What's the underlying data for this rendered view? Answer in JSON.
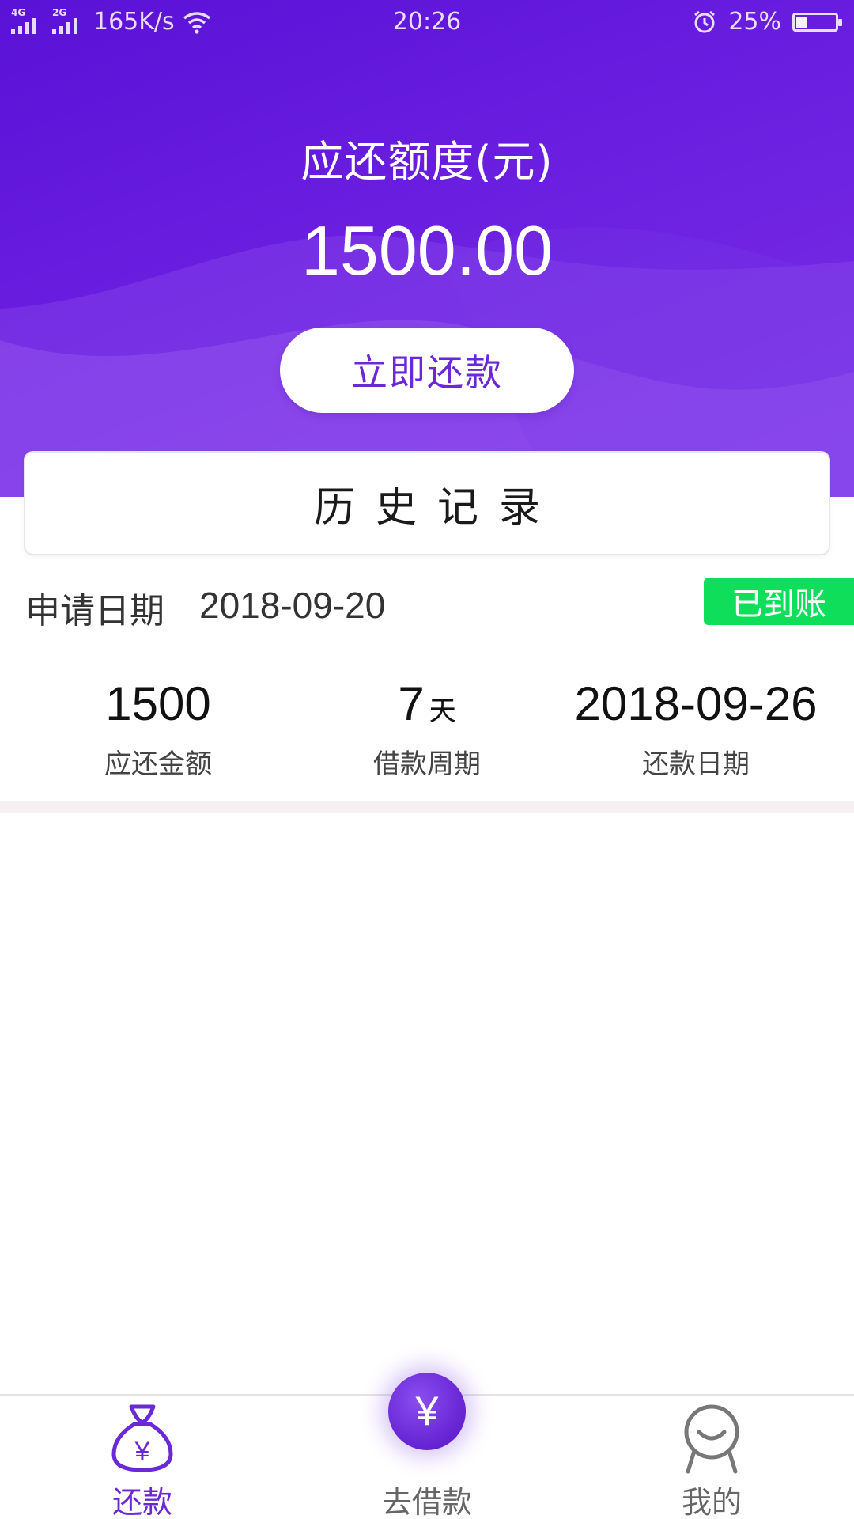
{
  "status_bar": {
    "network_1": "4G",
    "network_2": "2G",
    "speed": "165K/s",
    "time": "20:26",
    "battery_text": "25%",
    "battery_level": 0.25
  },
  "header": {
    "due_label": "应还额度(元)",
    "due_amount": "1500.00",
    "repay_button": "立即还款"
  },
  "history": {
    "title": "历史记录"
  },
  "record": {
    "apply_label": "申请日期",
    "apply_date": "2018-09-20",
    "status": "已到账",
    "stats": [
      {
        "value": "1500",
        "unit": "",
        "label": "应还金额"
      },
      {
        "value": "7",
        "unit": "天",
        "label": "借款周期"
      },
      {
        "value": "2018-09-26",
        "unit": "",
        "label": "还款日期"
      }
    ]
  },
  "tabbar": {
    "tabs": [
      {
        "label": "还款",
        "icon": "money-bag-icon"
      },
      {
        "label": "去借款",
        "icon": "yuan-coin-icon"
      },
      {
        "label": "我的",
        "icon": "profile-icon"
      }
    ],
    "center_symbol": "¥"
  },
  "colors": {
    "brand": "#6a28d6",
    "status_green": "#0ede5a"
  }
}
